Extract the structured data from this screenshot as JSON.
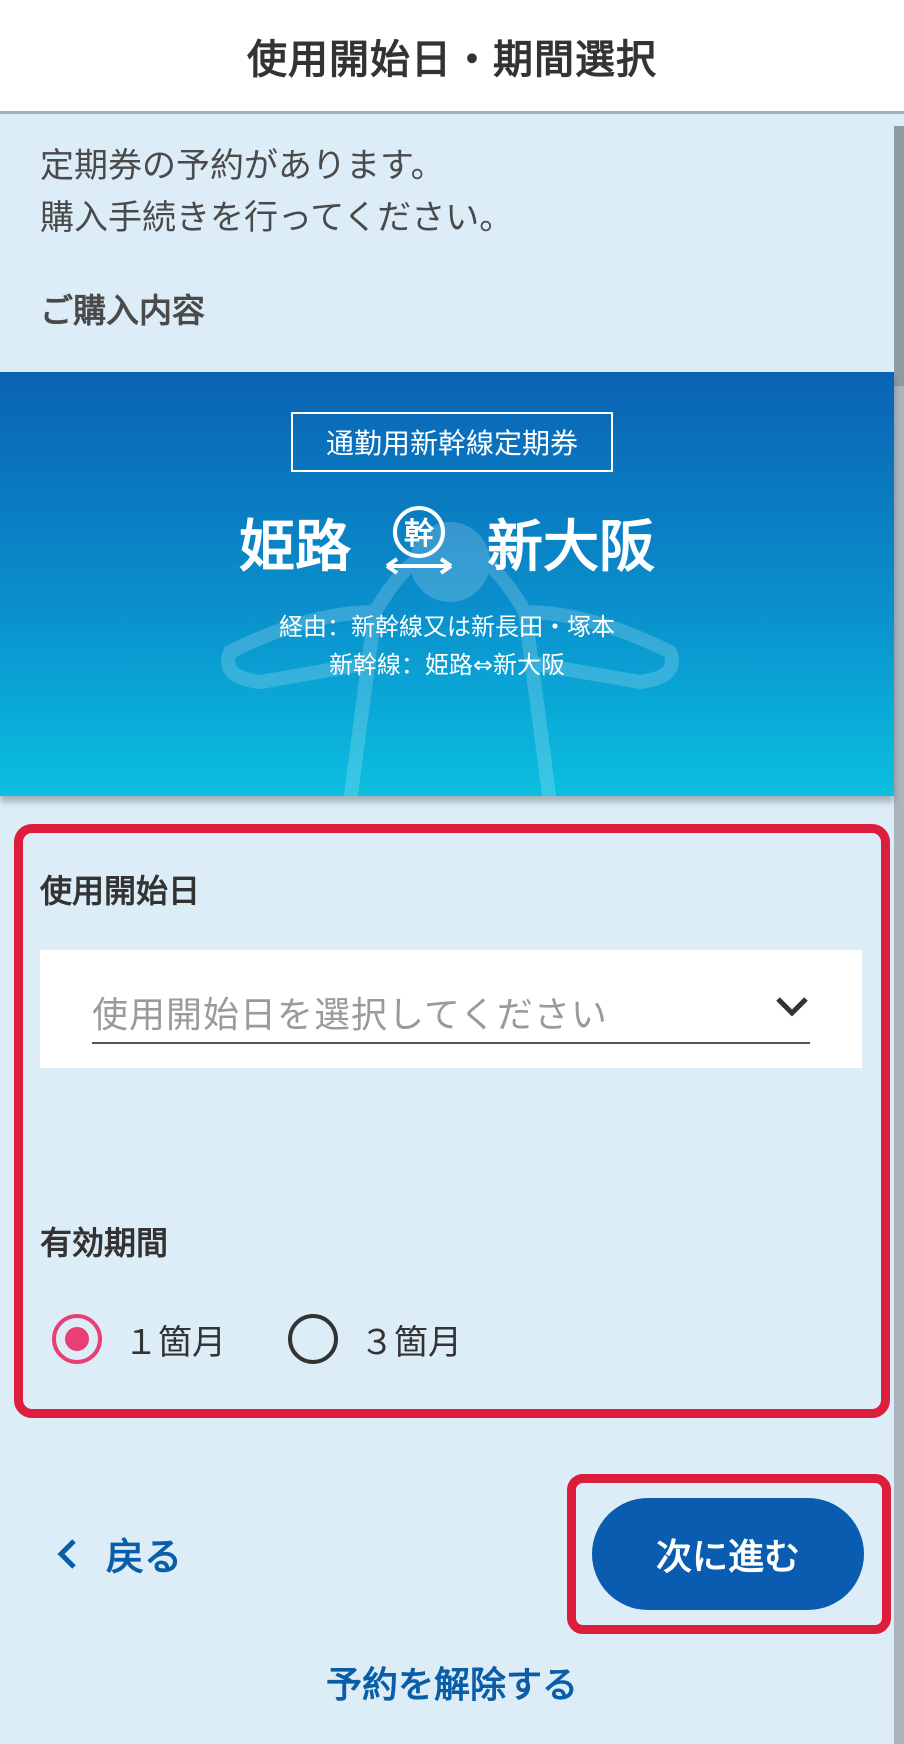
{
  "header": {
    "title": "使用開始日・期間選択"
  },
  "intro": {
    "line1": "定期券の予約があります。",
    "line2": "購入手続きを行ってください。"
  },
  "purchase_section_label": "ご購入内容",
  "ticket": {
    "type": "通勤用新幹線定期券",
    "from": "姫路",
    "to": "新大阪",
    "shinkansen_mark": "幹",
    "via_line1": "経由：新幹線又は新長田・塚本",
    "via_line2": "新幹線：姫路⇔新大阪"
  },
  "start_date": {
    "label": "使用開始日",
    "placeholder": "使用開始日を選択してください"
  },
  "validity": {
    "label": "有効期間",
    "options": [
      {
        "label": "１箇月",
        "selected": true
      },
      {
        "label": "３箇月",
        "selected": false
      }
    ]
  },
  "actions": {
    "back": "戻る",
    "next": "次に進む",
    "cancel": "予約を解除する"
  },
  "colors": {
    "accent": "#0a5cb0",
    "highlight": "#dc1e3c",
    "radio_selected": "#e93f77"
  }
}
